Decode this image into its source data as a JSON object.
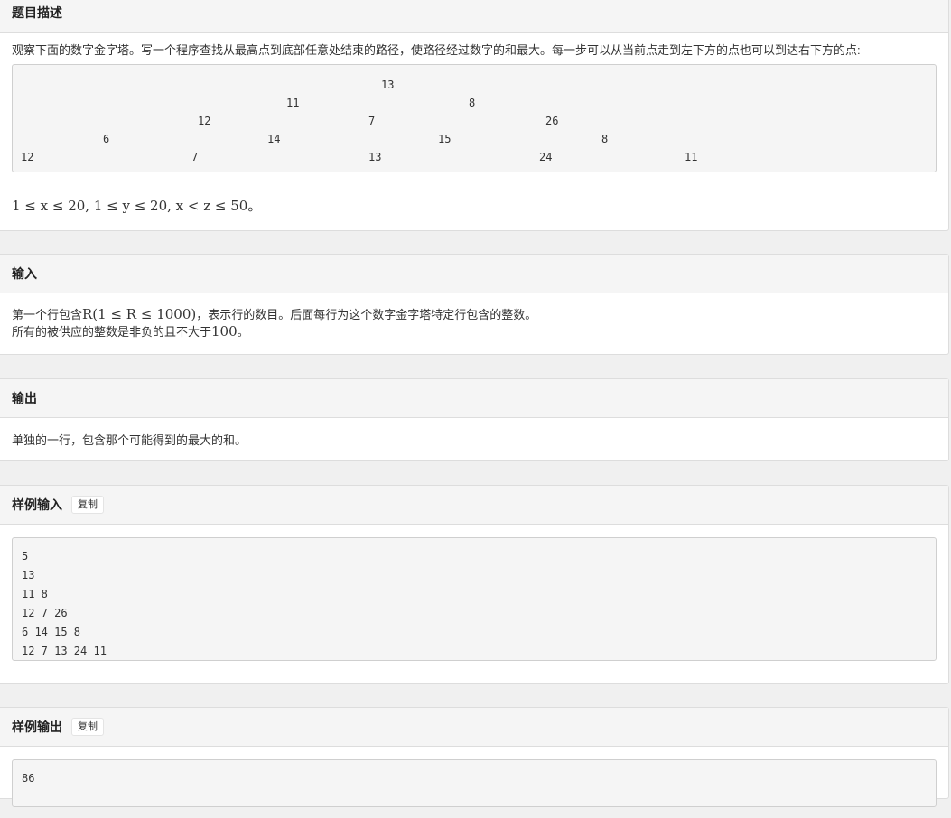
{
  "description": {
    "title": "题目描述",
    "text": "观察下面的数字金字塔。写一个程序查找从最高点到底部任意处结束的路径，使路径经过数字的和最大。每一步可以从当前点走到左下方的点也可以到达右下方的点:",
    "pyramid_rows": [
      [
        "13"
      ],
      [
        "11",
        "8"
      ],
      [
        "12",
        "7",
        "26"
      ],
      [
        "6",
        "14",
        "15",
        "8"
      ],
      [
        "12",
        "7",
        "13",
        "24",
        "11"
      ]
    ],
    "constraint": "1 ≤ x ≤ 20, 1 ≤ y ≤ 20, x < z ≤ 50。"
  },
  "input": {
    "title": "输入",
    "line1_pre": "第一个行包含",
    "line1_math": "R(1 ≤ R ≤ 1000)",
    "line1_post": "，表示行的数目。后面每行为这个数字金字塔特定行包含的整数。",
    "line2_pre": "所有的被供应的整数是非负的且不大于",
    "line2_math": "100",
    "line2_post": "。"
  },
  "output": {
    "title": "输出",
    "text": "单独的一行，包含那个可能得到的最大的和。"
  },
  "sample_input": {
    "title": "样例输入",
    "copy_label": "复制",
    "lines": [
      "5",
      "13",
      "11 8",
      "12 7 26",
      "6 14 15 8",
      "12 7 13 24 11"
    ]
  },
  "sample_output": {
    "title": "样例输出",
    "copy_label": "复制",
    "lines": [
      "86"
    ]
  }
}
